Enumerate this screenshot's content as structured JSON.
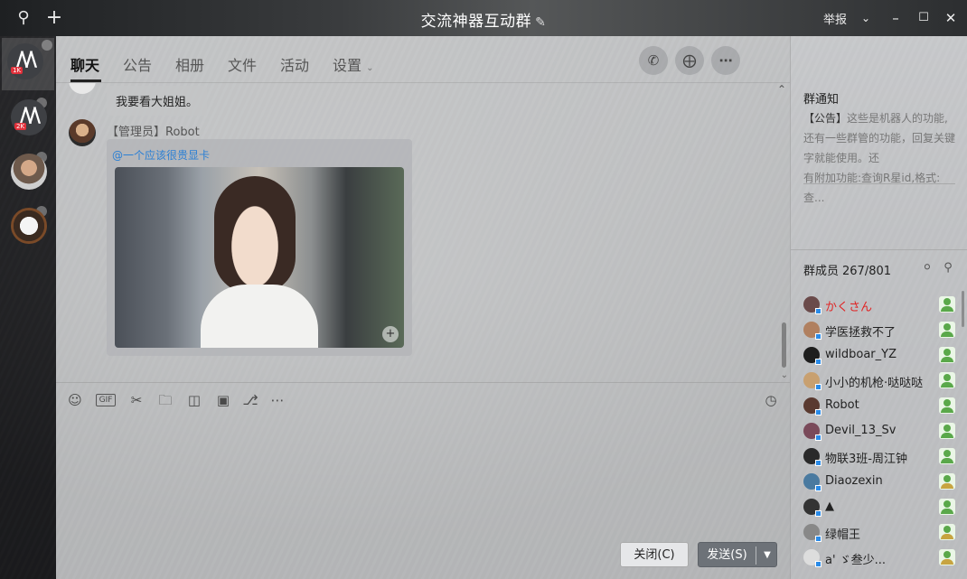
{
  "window": {
    "title": "交流神器互动群",
    "report_label": "举报",
    "icons": [
      "search-icon",
      "plus-icon",
      "edit-icon",
      "chevron-down-icon",
      "minimize-icon",
      "maximize-icon",
      "close-icon"
    ]
  },
  "sidebar": {
    "chats": [
      {
        "name": "chat-1",
        "badge": "1K",
        "active": true
      },
      {
        "name": "chat-2",
        "badge": "2K",
        "active": false
      },
      {
        "name": "chat-3",
        "badge": "",
        "active": false
      },
      {
        "name": "chat-4",
        "badge": "",
        "active": false
      }
    ]
  },
  "tabs": [
    {
      "label": "聊天",
      "active": true
    },
    {
      "label": "公告",
      "active": false
    },
    {
      "label": "相册",
      "active": false
    },
    {
      "label": "文件",
      "active": false
    },
    {
      "label": "活动",
      "active": false
    },
    {
      "label": "设置",
      "active": false
    }
  ],
  "header_actions": [
    "phone-icon",
    "add-chat-icon",
    "more-icon"
  ],
  "messages": {
    "prev_text": "我要看大姐姐。",
    "sender_name": "【管理员】Robot",
    "mention_text": "@一个应该很贵显卡"
  },
  "toolbar_tools": [
    "emoji-icon",
    "gif-icon",
    "scissors-icon",
    "folder-icon",
    "file-transfer-icon",
    "image-icon",
    "bell-icon",
    "more-icon",
    "history-clock-icon"
  ],
  "toolbar_gif_label": "GIF",
  "buttons": {
    "close_label": "关闭(C)",
    "send_label": "发送(S)"
  },
  "notice": {
    "title": "群通知",
    "tag": "【公告】",
    "line1": "这些是机器人的功能,",
    "line2": "还有一些群管的功能，回复关键",
    "line3": "字就能使用。还",
    "line4": "有附加功能:查询R星id,格式:查..."
  },
  "members": {
    "title": "群成员",
    "count": "267/801",
    "list": [
      {
        "name": "かくさん",
        "highlight": true,
        "role": "member"
      },
      {
        "name": "学医拯救不了",
        "highlight": false,
        "role": "member"
      },
      {
        "name": "wildboar_YZ",
        "highlight": false,
        "role": "member"
      },
      {
        "name": "小小的机枪·哒哒哒",
        "highlight": false,
        "role": "member"
      },
      {
        "name": "Robot",
        "highlight": false,
        "role": "member"
      },
      {
        "name": "Devil_13_Sv",
        "highlight": false,
        "role": "member"
      },
      {
        "name": "物联3班-周江钟",
        "highlight": false,
        "role": "member"
      },
      {
        "name": "Diaozexin",
        "highlight": false,
        "role": "star"
      },
      {
        "name": "▲",
        "highlight": false,
        "role": "member"
      },
      {
        "name": "绿帽王",
        "highlight": false,
        "role": "star"
      },
      {
        "name": "a' ゞ叁少...",
        "highlight": false,
        "role": "star"
      }
    ]
  },
  "colors": {
    "mention": "#2a7fd4",
    "highlight_name": "#e02424",
    "send_button": "#6d7278"
  }
}
